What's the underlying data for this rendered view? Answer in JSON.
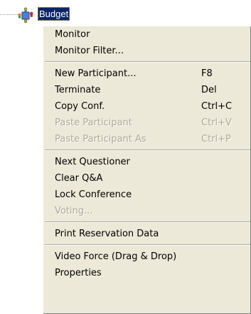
{
  "tree": {
    "node_label": "Budget",
    "node_icon": "conference-participants-icon"
  },
  "menu": {
    "groups": [
      [
        {
          "label": "Monitor",
          "shortcut": "",
          "enabled": true
        },
        {
          "label": "Monitor Filter...",
          "shortcut": "",
          "enabled": true
        }
      ],
      [
        {
          "label": "New Participant...",
          "shortcut": "F8",
          "enabled": true
        },
        {
          "label": "Terminate",
          "shortcut": "Del",
          "enabled": true
        },
        {
          "label": "Copy Conf.",
          "shortcut": "Ctrl+C",
          "enabled": true
        },
        {
          "label": "Paste Participant",
          "shortcut": "Ctrl+V",
          "enabled": false
        },
        {
          "label": "Paste Participant As",
          "shortcut": "Ctrl+P",
          "enabled": false
        }
      ],
      [
        {
          "label": "Next Questioner",
          "shortcut": "",
          "enabled": true
        },
        {
          "label": "Clear Q&A",
          "shortcut": "",
          "enabled": true
        },
        {
          "label": "Lock Conference",
          "shortcut": "",
          "enabled": true
        },
        {
          "label": "Voting...",
          "shortcut": "",
          "enabled": false
        }
      ],
      [
        {
          "label": "Print Reservation Data",
          "shortcut": "",
          "enabled": true
        }
      ],
      [
        {
          "label": "Video Force (Drag & Drop)",
          "shortcut": "",
          "enabled": true
        },
        {
          "label": "Properties",
          "shortcut": "",
          "enabled": true
        }
      ]
    ]
  },
  "colors": {
    "menu_bg": "#ece9d8",
    "selection_bg": "#0a246a",
    "disabled_text": "#aca899"
  }
}
